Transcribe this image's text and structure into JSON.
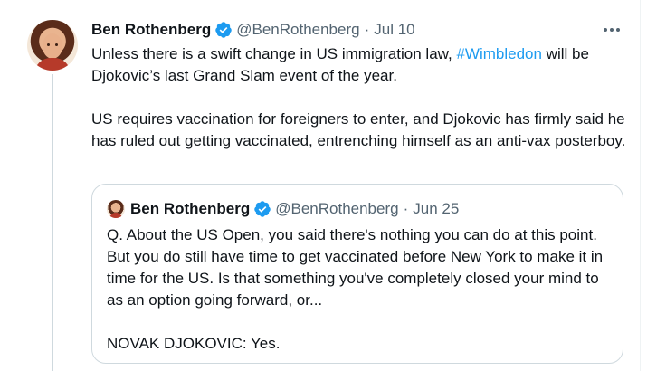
{
  "tweet": {
    "author_name": "Ben Rothenberg",
    "handle": "@BenRothenberg",
    "separator": "·",
    "date": "Jul 10",
    "text_before_hashtag": "Unless there is a swift change in US immigration law, ",
    "hashtag": "#Wimbledon",
    "text_after_hashtag": " will be Djokovic’s last Grand Slam event of the year.",
    "paragraph_2": "US requires vaccination for foreigners to enter, and Djokovic has firmly said he has ruled out getting vaccinated, entrenching himself as an anti-vax posterboy."
  },
  "quoted_tweet": {
    "author_name": "Ben Rothenberg",
    "handle": "@BenRothenberg",
    "separator": "·",
    "date": "Jun 25",
    "paragraph_1": "Q. About the US Open, you said there's nothing you can do at this point. But you do still have time to get vaccinated before New York to make it in time for the US. Is that something you've completely closed your mind to as an option going forward, or...",
    "paragraph_2": "NOVAK DJOKOVIC: Yes."
  },
  "colors": {
    "verified_badge": "#1d9bf0",
    "hashtag": "#1d9bf0",
    "secondary_text": "#536471",
    "border": "#cfd9de"
  },
  "icons": [
    "verified-badge-icon",
    "more-options-icon"
  ]
}
